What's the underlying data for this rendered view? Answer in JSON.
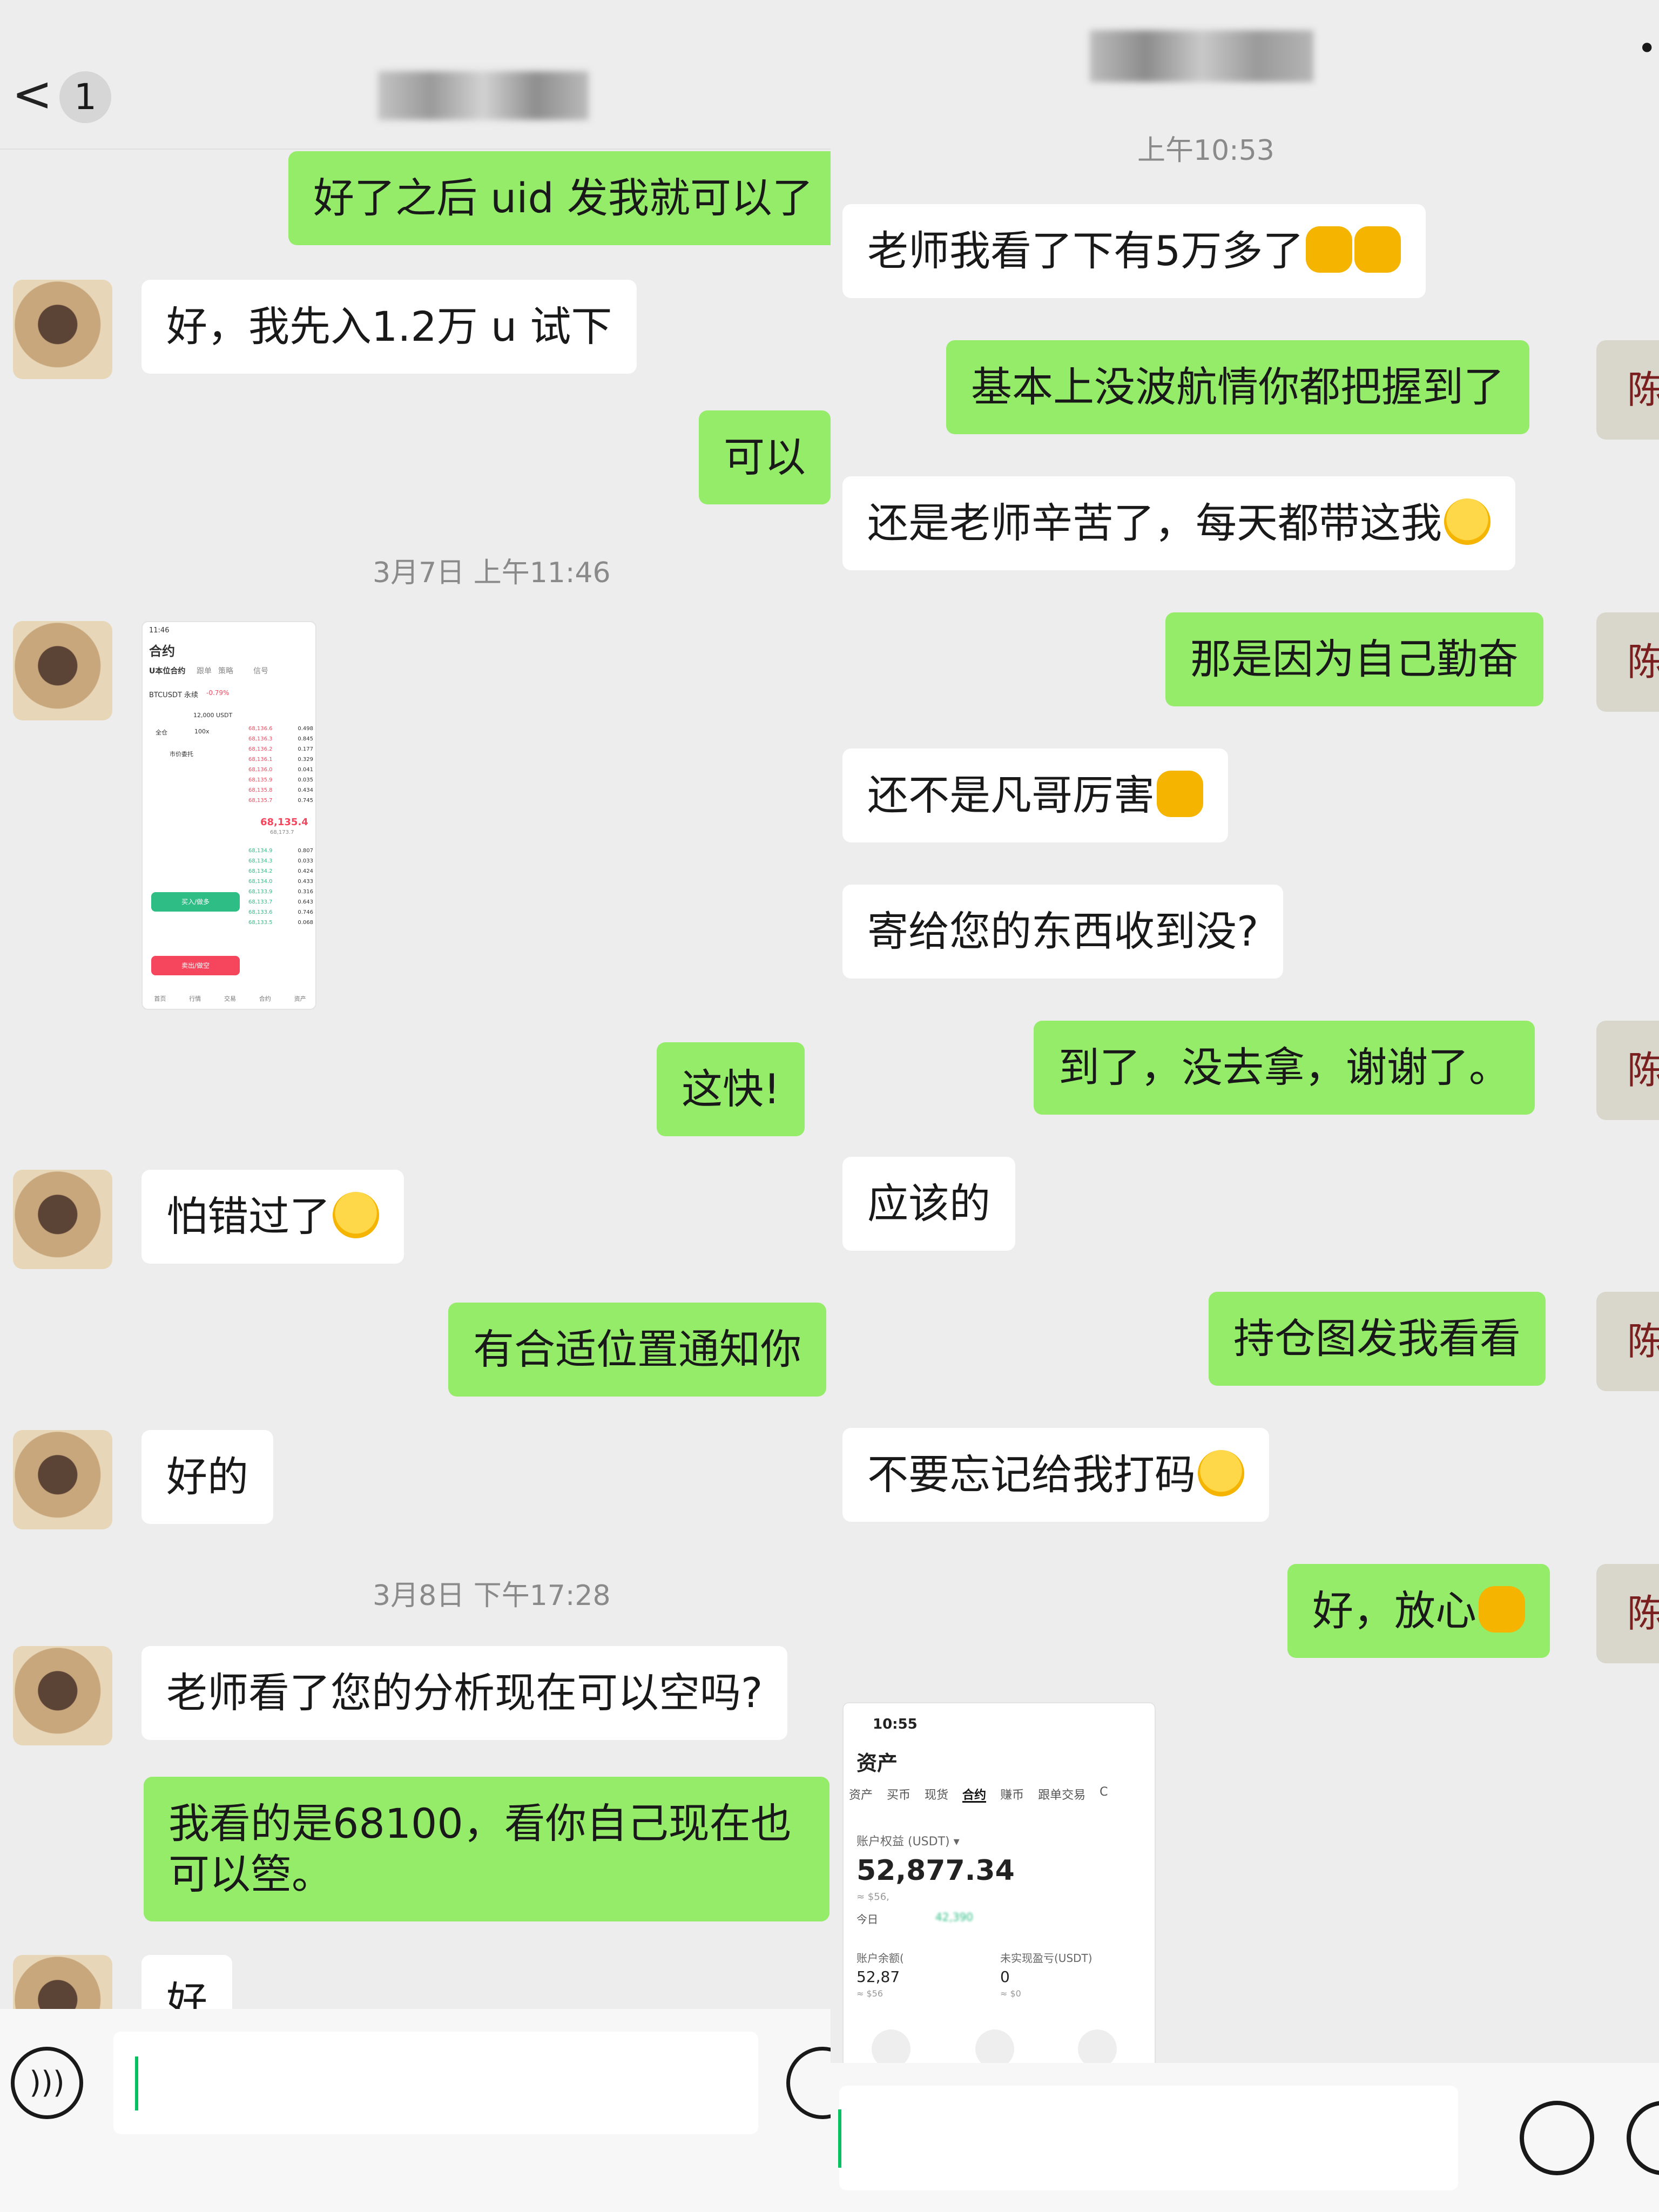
{
  "left": {
    "header": {
      "back_label": "<",
      "unread_count": "1",
      "contact_name_blurred": "▇▇▇▇▇"
    },
    "messages": [
      {
        "side": "out",
        "text": "好了之后 uid 发我就可以了"
      },
      {
        "side": "in",
        "text": "好，我先入1.2万 u 试下"
      },
      {
        "side": "out",
        "text": "可以"
      },
      {
        "side": "time",
        "text": "3月7日 上午11:46"
      },
      {
        "side": "out",
        "text": "这快!"
      },
      {
        "side": "in",
        "text": "怕错过了"
      },
      {
        "side": "out",
        "text": "有合适位置通知你"
      },
      {
        "side": "in",
        "text": "好的"
      },
      {
        "side": "time",
        "text": "3月8日 下午17:28"
      },
      {
        "side": "in",
        "text": "老师看了您的分析现在可以空吗?"
      },
      {
        "side": "out",
        "text": "我看的是68100，看你自己现在也可以箜。"
      },
      {
        "side": "in",
        "text": "好"
      }
    ],
    "screenshot": {
      "time": "11:46",
      "title": "合约",
      "tabs": [
        "U本位合约",
        "跟单",
        "策略",
        "信号"
      ],
      "pair": "BTCUSDT 永续",
      "change": "-0.79%",
      "price": "68,135.4",
      "sub_price": "68,173.7",
      "buy_label": "买入/做多",
      "sell_label": "卖出/做空",
      "order_type": "市价委托",
      "leverage": "100x",
      "mode": "全仓",
      "available": "12,000 USDT",
      "asks": [
        [
          "68,136.6",
          "0.498"
        ],
        [
          "68,136.3",
          "0.845"
        ],
        [
          "68,136.2",
          "0.177"
        ],
        [
          "68,136.1",
          "0.329"
        ],
        [
          "68,136.0",
          "0.041"
        ],
        [
          "68,135.9",
          "0.035"
        ],
        [
          "68,135.8",
          "0.434"
        ],
        [
          "68,135.7",
          "0.745"
        ]
      ],
      "bids": [
        [
          "68,134.9",
          "0.807"
        ],
        [
          "68,134.3",
          "0.033"
        ],
        [
          "68,134.2",
          "0.424"
        ],
        [
          "68,134.0",
          "0.433"
        ],
        [
          "68,133.9",
          "0.316"
        ],
        [
          "68,133.7",
          "0.643"
        ],
        [
          "68,133.6",
          "0.746"
        ],
        [
          "68,133.5",
          "0.068"
        ]
      ],
      "nav": [
        "首页",
        "行情",
        "交易",
        "合约",
        "资产"
      ]
    }
  },
  "right": {
    "header": {
      "contact_name_blurred": "▇▇▇▇▇▇▇",
      "more": "•"
    },
    "messages": [
      {
        "side": "time",
        "text": "上午10:53"
      },
      {
        "side": "in",
        "text": "老师我看了下有5万多了"
      },
      {
        "side": "out",
        "text": "基本上没波航情你都把握到了"
      },
      {
        "side": "in",
        "text": "还是老师辛苦了，每天都带这我"
      },
      {
        "side": "out",
        "text": "那是因为自己勤奋"
      },
      {
        "side": "in",
        "text": "还不是凡哥厉害"
      },
      {
        "side": "in",
        "text": "寄给您的东西收到没?"
      },
      {
        "side": "out",
        "text": "到了，没去拿，谢谢了。"
      },
      {
        "side": "in",
        "text": "应该的"
      },
      {
        "side": "out",
        "text": "持仓图发我看看"
      },
      {
        "side": "in",
        "text": "不要忘记给我打码"
      },
      {
        "side": "out",
        "text": "好，放心"
      }
    ],
    "avatar_glyph": "陈",
    "screenshot": {
      "time": "10:55",
      "title": "资产",
      "tabs": [
        "资产",
        "买币",
        "现货",
        "合约",
        "赚币",
        "跟单交易",
        "C"
      ],
      "equity_label": "账户权益 (USDT) ▾",
      "equity_value": "52,877.34",
      "equity_sub": "≈ $56,",
      "today_label": "今日",
      "today_value": "42,390",
      "balance_label": "账户余额(",
      "balance_value": "52,87",
      "balance_sub": "≈ $56",
      "pnl_label": "未实现盈亏(USDT)",
      "pnl_value": "0",
      "pnl_sub": "≈ $0"
    }
  },
  "colors": {
    "outgoing": "#95ec69",
    "incoming": "#ffffff",
    "background": "#ededed",
    "buy": "#2ebd85",
    "sell": "#f6465d"
  }
}
